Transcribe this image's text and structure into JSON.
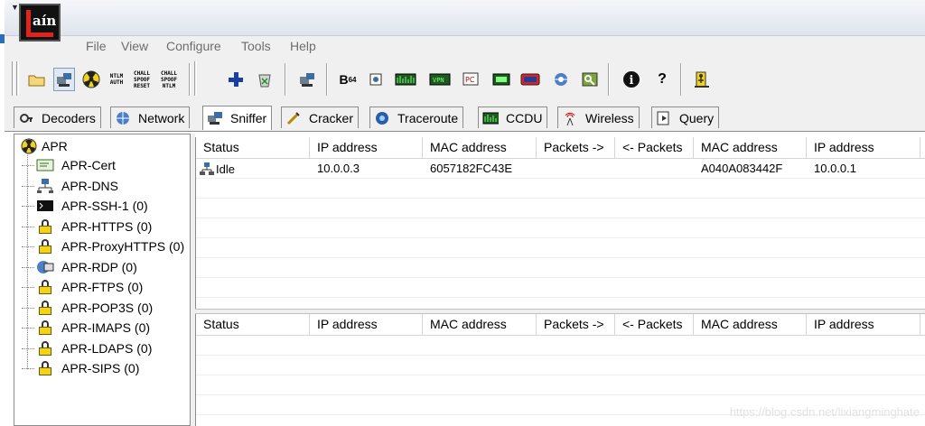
{
  "app": {
    "logo_text": "aín"
  },
  "menu": [
    "File",
    "View",
    "Configure",
    "Tools",
    "Help"
  ],
  "toolbar": {
    "buttons": [
      {
        "name": "open-folder-icon"
      },
      {
        "name": "start-sniffer-icon"
      },
      {
        "name": "start-apr-icon"
      },
      {
        "name": "ntlm-auth-icon",
        "text": "NTLM AUTH"
      },
      {
        "name": "chall-spoof-reset-icon",
        "text": "CHALL SPOOF RESET"
      },
      {
        "name": "chall-spoof-ntlm-icon",
        "text": "CHALL SPOOF NTLM"
      },
      {
        "name": "add-icon"
      },
      {
        "name": "remove-icon"
      },
      {
        "name": "sniffer-icon"
      },
      {
        "name": "base64-icon",
        "text": "B64"
      },
      {
        "name": "lsa-secrets-icon"
      },
      {
        "name": "wordlist-icon"
      },
      {
        "name": "vpn-icon",
        "text": "VPN"
      },
      {
        "name": "pc-icon",
        "text": "PC"
      },
      {
        "name": "ccdu-icon"
      },
      {
        "name": "network-card-icon"
      },
      {
        "name": "ie-icon"
      },
      {
        "name": "key-icon"
      },
      {
        "name": "info-icon"
      },
      {
        "name": "help-icon"
      },
      {
        "name": "exit-icon"
      }
    ]
  },
  "tabs": [
    {
      "label": "Decoders",
      "icon": "decoders-icon"
    },
    {
      "label": "Network",
      "icon": "network-icon"
    },
    {
      "label": "Sniffer",
      "icon": "sniffer-icon",
      "active": true
    },
    {
      "label": "Cracker",
      "icon": "cracker-icon"
    },
    {
      "label": "Traceroute",
      "icon": "traceroute-icon"
    },
    {
      "label": "CCDU",
      "icon": "ccdu-icon"
    },
    {
      "label": "Wireless",
      "icon": "wireless-icon"
    },
    {
      "label": "Query",
      "icon": "query-icon"
    }
  ],
  "tree": {
    "root": "APR",
    "items": [
      {
        "label": "APR-Cert",
        "icon": "certificate-icon"
      },
      {
        "label": "APR-DNS",
        "icon": "dns-network-icon"
      },
      {
        "label": "APR-SSH-1 (0)",
        "icon": "terminal-icon"
      },
      {
        "label": "APR-HTTPS (0)",
        "icon": "lock-icon"
      },
      {
        "label": "APR-ProxyHTTPS (0)",
        "icon": "lock-icon"
      },
      {
        "label": "APR-RDP (0)",
        "icon": "remote-desktop-icon"
      },
      {
        "label": "APR-FTPS (0)",
        "icon": "lock-icon"
      },
      {
        "label": "APR-POP3S (0)",
        "icon": "lock-icon"
      },
      {
        "label": "APR-IMAPS (0)",
        "icon": "lock-icon"
      },
      {
        "label": "APR-LDAPS (0)",
        "icon": "lock-icon"
      },
      {
        "label": "APR-SIPS (0)",
        "icon": "lock-icon"
      }
    ]
  },
  "columns": [
    "Status",
    "IP address",
    "MAC address",
    "Packets ->",
    "<- Packets",
    "MAC address",
    "IP address"
  ],
  "top_rows": [
    {
      "status": "Idle",
      "ip1": "10.0.0.3",
      "mac1": "6057182FC43E",
      "pkts_out": "",
      "pkts_in": "",
      "mac2": "A040A083442F",
      "ip2": "10.0.0.1"
    }
  ],
  "watermark": "https://blog.csdn.net/lixiangminghate"
}
